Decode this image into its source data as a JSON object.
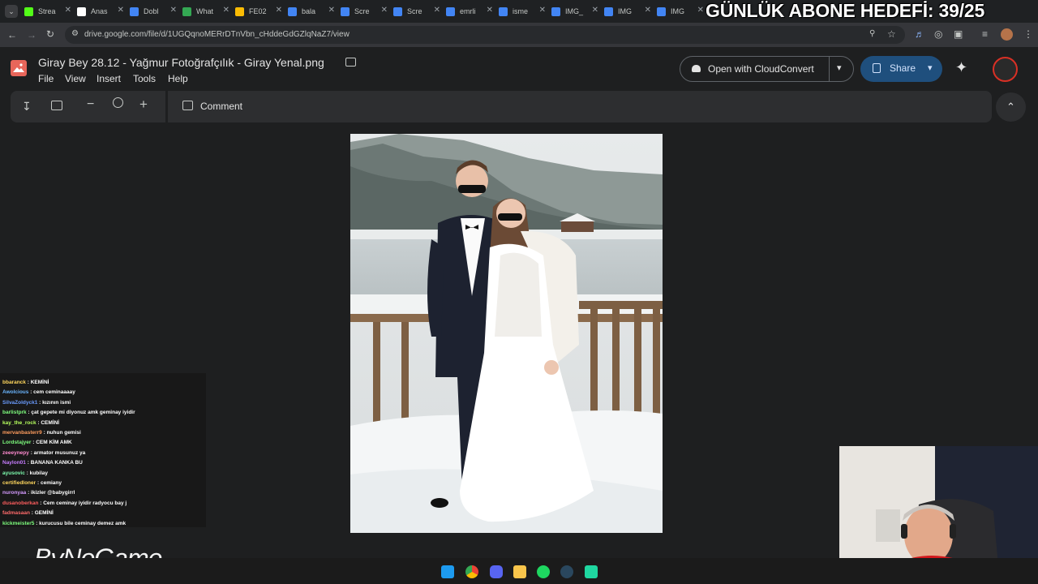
{
  "browser": {
    "tabs": [
      {
        "label": "Strea",
        "color": "#53fc18"
      },
      {
        "label": "Anas",
        "color": "#ffffff"
      },
      {
        "label": "Dobl",
        "color": "#4285f4"
      },
      {
        "label": "What",
        "color": "#34a853"
      },
      {
        "label": "FE02",
        "color": "#fbbc04"
      },
      {
        "label": "bala",
        "color": "#4285f4"
      },
      {
        "label": "Scre",
        "color": "#4285f4"
      },
      {
        "label": "Scre",
        "color": "#4285f4"
      },
      {
        "label": "emrli",
        "color": "#4285f4"
      },
      {
        "label": "isme",
        "color": "#4285f4"
      },
      {
        "label": "IMG_",
        "color": "#4285f4"
      },
      {
        "label": "IMG",
        "color": "#4285f4"
      },
      {
        "label": "IMG",
        "color": "#4285f4"
      }
    ],
    "url": "drive.google.com/file/d/1UGQqnoMERrDTnVbn_cHddeGdGZlqNaZ7/view"
  },
  "overlay": {
    "goal_text": "GÜNLÜK ABONE HEDEFİ: 39/25",
    "brand": "ByNoGame"
  },
  "drive": {
    "file_title": "Giray Bey 28.12 - Yağmur Fotoğrafçılık - Giray Yenal.png",
    "menu": [
      "File",
      "View",
      "Insert",
      "Tools",
      "Help"
    ],
    "open_with_label": "Open with CloudConvert",
    "share_label": "Share",
    "comment_label": "Comment"
  },
  "chat": [
    {
      "user": "bbaranck",
      "msg": "KEMİNİ",
      "color": "#ffd75e"
    },
    {
      "user": "Awolcious",
      "msg": "cem ceminaaaay",
      "color": "#6bb6ff"
    },
    {
      "user": "SilvaZoldyck1",
      "msg": "kızının ismi",
      "color": "#6b9cff"
    },
    {
      "user": "barlistprk",
      "msg": "çat gepete mi diyonuz amk geminay iyidir",
      "color": "#7fff7f"
    },
    {
      "user": "kay_the_rock",
      "msg": "CEMİNİ",
      "color": "#b6ff5e"
    },
    {
      "user": "mervanbasterr9",
      "msg": "nuhun gemisi",
      "color": "#ff9d5e"
    },
    {
      "user": "Lordstajyer",
      "msg": "CEM KİM AMK",
      "color": "#7fff7f"
    },
    {
      "user": "zeeeynepy",
      "msg": "armator musunuz ya",
      "color": "#ff8bd0"
    },
    {
      "user": "Naylon01",
      "msg": "BANANA KANKA BU",
      "color": "#c77dff"
    },
    {
      "user": "ayusovic",
      "msg": "kubilay",
      "color": "#7fffb0"
    },
    {
      "user": "certifiedloner",
      "msg": "cemiany",
      "color": "#ffd75e"
    },
    {
      "user": "nuronyaa",
      "msg": "ikizler @babygirrl",
      "color": "#d59bff"
    },
    {
      "user": "dusanoberkan",
      "msg": "Cem ceminay iyidir radyocu bay j",
      "color": "#ff5e5e"
    },
    {
      "user": "fadmasaan",
      "msg": "GEMİNİ",
      "color": "#ff6b6b"
    },
    {
      "user": "kickmeister5",
      "msg": "kurucusu bile ceminay demez amk",
      "color": "#7fff7f"
    }
  ]
}
